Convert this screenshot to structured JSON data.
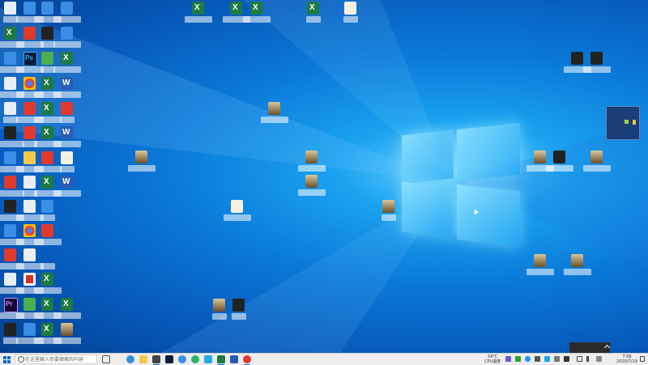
{
  "taskbar": {
    "search_placeholder": "在这里输入你要搜索的内容",
    "weather": {
      "temp": "34°C",
      "label": "CPU温度"
    },
    "clock": {
      "time": "7:58",
      "date": "2020/7/19"
    }
  },
  "colors": {
    "accent": "#0a66c2",
    "wallpaper": "#0a78d8",
    "taskbar": "#ededed"
  },
  "icons": {
    "start": "windows-logo-icon",
    "search": "search-icon",
    "desktop_file_types": [
      "excel-icon",
      "word-icon",
      "photoshop-icon",
      "premiere-icon",
      "pdf-icon",
      "picture-file-icon",
      "folder-icon",
      "chrome-icon"
    ]
  }
}
